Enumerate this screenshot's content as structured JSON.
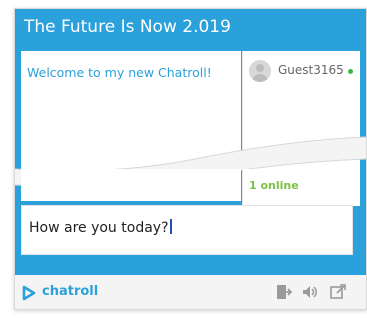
{
  "widget": {
    "title": "The Future Is Now 2.019",
    "welcome_message": "Welcome to my new Chatroll!",
    "users": [
      {
        "name": "Guest3165",
        "status": "online"
      }
    ],
    "online_count": "1 online",
    "input_value": "How are you today?",
    "brand": "chatroll",
    "footer_icons": [
      "exit-icon",
      "volume-icon",
      "popout-icon"
    ],
    "colors": {
      "accent": "#2aa1db",
      "online": "#3ab54a",
      "online_text": "#7cc243"
    }
  }
}
